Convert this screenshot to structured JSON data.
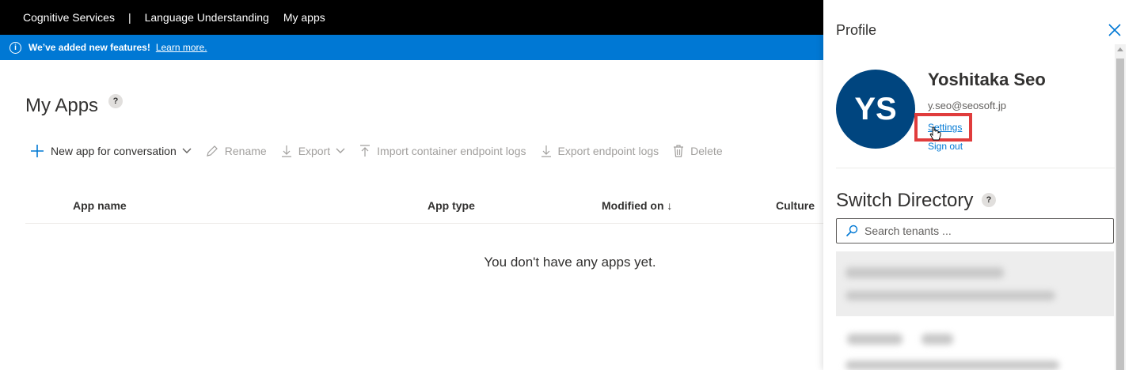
{
  "topbar": {
    "brand": "Cognitive Services",
    "separator": "|",
    "product": "Language Understanding",
    "nav_myapps": "My apps"
  },
  "banner": {
    "info_icon": "info-icon",
    "message": "We’ve added new features!",
    "link": "Learn more."
  },
  "page": {
    "title": "My Apps",
    "help": "?"
  },
  "toolbar": {
    "new_app": "New app for conversation",
    "rename": "Rename",
    "export": "Export",
    "import_logs": "Import container endpoint logs",
    "export_logs": "Export endpoint logs",
    "delete": "Delete"
  },
  "table": {
    "columns": [
      "App name",
      "App type",
      "Modified on ↓",
      "Culture"
    ],
    "empty_message": "You don't have any apps yet."
  },
  "profile": {
    "title": "Profile",
    "initials": "YS",
    "name": "Yoshitaka Seo",
    "email": "y.seo@seosoft.jp",
    "settings": "Settings",
    "signout": "Sign out"
  },
  "directory": {
    "title": "Switch Directory",
    "help": "?",
    "search_placeholder": "Search tenants ..."
  },
  "colors": {
    "accent": "#0078d4",
    "avatar": "#00457f",
    "highlight": "#e03c3c"
  }
}
